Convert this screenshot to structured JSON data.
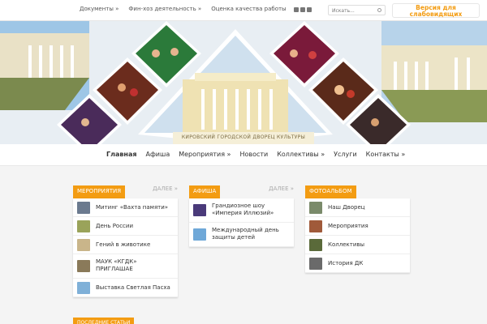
{
  "topbar": {
    "menu": [
      "Документы »",
      "Фин-хоз деятельность »",
      "Оценка качества работы"
    ],
    "search_placeholder": "Искать...",
    "vision_button": "Версия для слабовидящих"
  },
  "banner": {
    "caption": "КИРОВСКИЙ ГОРОДСКОЙ ДВОРЕЦ КУЛЬТУРЫ"
  },
  "nav": {
    "items": [
      "Главная",
      "Афиша",
      "Мероприятия »",
      "Новости",
      "Коллективы »",
      "Услуги",
      "Контакты »"
    ]
  },
  "widgets": [
    {
      "title": "МЕРОПРИЯТИЯ",
      "more": "ДАЛЕЕ »",
      "items": [
        "Митинг «Вахта памяти»",
        "День России",
        "Гений в животике",
        "МАУК «КГДК» ПРИГЛАШАЕ",
        "Выставка Светлая Пасха"
      ]
    },
    {
      "title": "АФИША",
      "more": "ДАЛЕЕ »",
      "items": [
        "Грандиозное шоу «Империя Иллюзий»",
        "Международный день защиты детей"
      ]
    },
    {
      "title": "ФОТОАЛЬБОМ",
      "items": [
        "Наш Дворец",
        "Мероприятия",
        "Коллективы",
        "История ДК"
      ]
    }
  ],
  "bottom_tab": "ПОСЛЕДНИЕ СТАТЬИ",
  "colors": {
    "accent": "#f39c12",
    "background": "#f4f4f4"
  }
}
